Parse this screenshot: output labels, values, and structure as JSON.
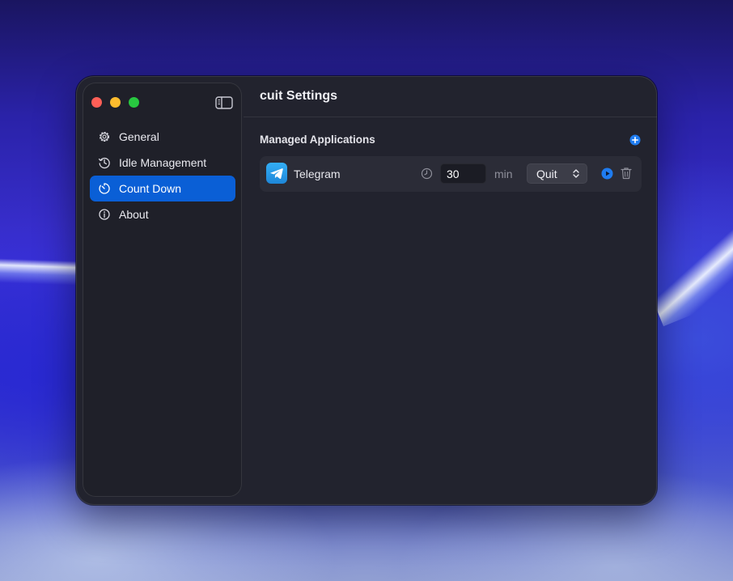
{
  "window": {
    "title": "cuit Settings"
  },
  "sidebar": {
    "items": [
      {
        "label": "General",
        "icon": "gear-icon",
        "selected": false
      },
      {
        "label": "Idle Management",
        "icon": "history-icon",
        "selected": false
      },
      {
        "label": "Count Down",
        "icon": "timer-icon",
        "selected": true
      },
      {
        "label": "About",
        "icon": "info-icon",
        "selected": false
      }
    ]
  },
  "main": {
    "section_title": "Managed Applications",
    "add_icon": "plus-circle-icon",
    "apps": [
      {
        "name": "Telegram",
        "icon": "telegram-icon",
        "minutes": "30",
        "unit": "min",
        "action": "Quit"
      }
    ]
  },
  "colors": {
    "accent": "#0a5fd6",
    "window_bg": "#22232e",
    "sidebar_bg": "#1f2029",
    "row_bg": "#2b2c37",
    "blue_button": "#1f7cf0",
    "close": "#ff5f57",
    "minimize": "#febc2e",
    "zoom": "#28c840"
  }
}
